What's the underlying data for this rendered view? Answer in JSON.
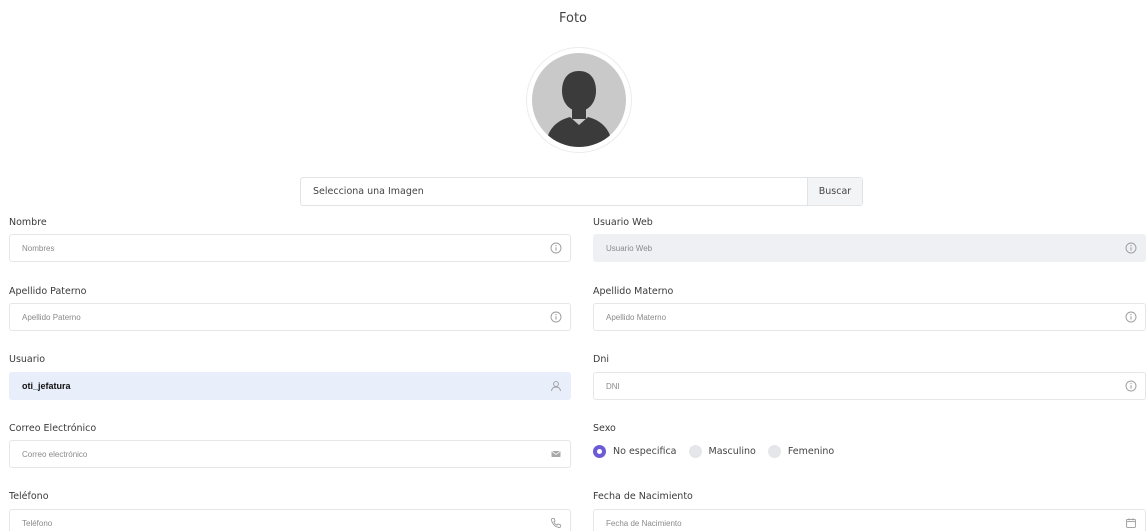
{
  "photo": {
    "title": "Foto",
    "file_placeholder": "Selecciona una Imagen",
    "browse_label": "Buscar"
  },
  "form": {
    "nombre": {
      "label": "Nombre",
      "placeholder": "Nombres",
      "icon": "info-icon"
    },
    "usuario_web": {
      "label": "Usuario Web",
      "placeholder": "Usuario Web",
      "icon": "info-icon"
    },
    "apellido_paterno": {
      "label": "Apellido Paterno",
      "placeholder": "Apellido Paterno",
      "icon": "info-icon"
    },
    "apellido_materno": {
      "label": "Apellido Materno",
      "placeholder": "Apellido Materno",
      "icon": "info-icon"
    },
    "usuario": {
      "label": "Usuario",
      "value": "oti_jefatura",
      "icon": "user-icon"
    },
    "dni": {
      "label": "Dni",
      "placeholder": "DNI",
      "icon": "info-icon"
    },
    "correo": {
      "label": "Correo Electrónico",
      "placeholder": "Correo electrónico",
      "icon": "envelope-icon"
    },
    "sexo": {
      "label": "Sexo",
      "options": [
        "No especifica",
        "Masculino",
        "Femenino"
      ],
      "selected": "No especifica"
    },
    "telefono": {
      "label": "Teléfono",
      "placeholder": "Teléfono",
      "icon": "phone-icon"
    },
    "fecha_nacimiento": {
      "label": "Fecha de Nacimiento",
      "placeholder": "Fecha de Nacimiento",
      "icon": "calendar-icon"
    }
  },
  "colors": {
    "accent": "#6b5bd6",
    "disabled_bg": "#eef0f4",
    "filled_bg": "#e8eefa"
  }
}
